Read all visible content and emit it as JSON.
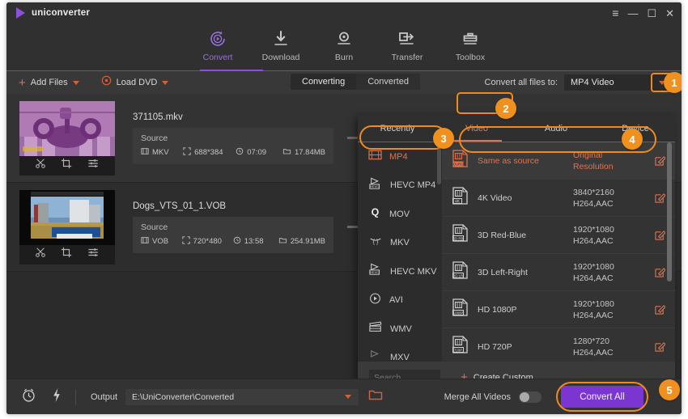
{
  "window": {
    "app_name": "uniconverter",
    "controls": {
      "menu": "≡",
      "minimize": "—",
      "maximize": "☐",
      "close": "✕"
    }
  },
  "nav": {
    "items": [
      {
        "label": "Convert",
        "icon": "convert-icon",
        "active": true
      },
      {
        "label": "Download",
        "icon": "download-icon",
        "active": false
      },
      {
        "label": "Burn",
        "icon": "burn-icon",
        "active": false
      },
      {
        "label": "Transfer",
        "icon": "transfer-icon",
        "active": false
      },
      {
        "label": "Toolbox",
        "icon": "toolbox-icon",
        "active": false
      }
    ]
  },
  "toolbar": {
    "add_files": "Add Files",
    "load_dvd": "Load DVD",
    "tabs": [
      {
        "label": "Converting",
        "active": true
      },
      {
        "label": "Converted",
        "active": false
      }
    ],
    "convert_all_caption": "Convert all files to:",
    "convert_all_value": "MP4 Video"
  },
  "files": [
    {
      "name": "371105.mkv",
      "source_label": "Source",
      "container": "MKV",
      "resolution": "688*384",
      "duration": "07:09",
      "size": "17.84MB"
    },
    {
      "name": "Dogs_VTS_01_1.VOB",
      "source_label": "Source",
      "container": "VOB",
      "resolution": "720*480",
      "duration": "13:58",
      "size": "254.91MB"
    }
  ],
  "panel": {
    "tabs": [
      {
        "label": "Recently",
        "active": false
      },
      {
        "label": "Video",
        "active": true
      },
      {
        "label": "Audio",
        "active": false
      },
      {
        "label": "Device",
        "active": false
      }
    ],
    "formats": [
      {
        "label": "MP4",
        "icon": "film-strip-icon",
        "active": true
      },
      {
        "label": "HEVC MP4",
        "icon": "hevc-icon",
        "active": false
      },
      {
        "label": "MOV",
        "icon": "quicktime-icon",
        "active": false
      },
      {
        "label": "MKV",
        "icon": "mkv-icon",
        "active": false
      },
      {
        "label": "HEVC MKV",
        "icon": "hevc-icon",
        "active": false
      },
      {
        "label": "AVI",
        "icon": "play-circle-icon",
        "active": false
      },
      {
        "label": "WMV",
        "icon": "clapperboard-icon",
        "active": false
      },
      {
        "label": "MXV",
        "icon": "play-flag-icon",
        "active": false
      }
    ],
    "resolutions": [
      {
        "name": "Same as source",
        "spec_line1": "Original Resolution",
        "spec_line2": "",
        "badge": "SOURCE",
        "active": true
      },
      {
        "name": "4K Video",
        "spec_line1": "3840*2160",
        "spec_line2": "H264,AAC",
        "badge": "4K",
        "active": false
      },
      {
        "name": "3D Red-Blue",
        "spec_line1": "1920*1080",
        "spec_line2": "H264,AAC",
        "badge": "3D RB",
        "active": false
      },
      {
        "name": "3D Left-Right",
        "spec_line1": "1920*1080",
        "spec_line2": "H264,AAC",
        "badge": "3D LR",
        "active": false
      },
      {
        "name": "HD 1080P",
        "spec_line1": "1920*1080",
        "spec_line2": "H264,AAC",
        "badge": "1080P",
        "active": false
      },
      {
        "name": "HD 720P",
        "spec_line1": "1280*720",
        "spec_line2": "H264,AAC",
        "badge": "720P",
        "active": false
      }
    ],
    "search_placeholder": "Search",
    "create_custom": "Create Custom"
  },
  "bottom": {
    "output_label": "Output",
    "output_path": "E:\\UniConverter\\Converted",
    "merge_label": "Merge All Videos",
    "merge_on": false,
    "convert_all_button": "Convert All"
  },
  "callouts": [
    {
      "number": "1"
    },
    {
      "number": "2"
    },
    {
      "number": "3"
    },
    {
      "number": "4"
    },
    {
      "number": "5"
    }
  ],
  "colors": {
    "accent_purple": "#7b35d1",
    "accent_orange": "#e0734e",
    "callout_orange": "#f0901e",
    "panel_bg": "#2f2f2f"
  }
}
